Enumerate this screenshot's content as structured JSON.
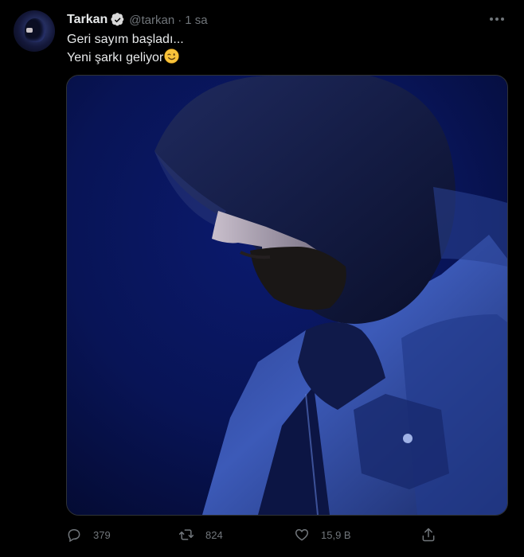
{
  "tweet": {
    "author_name": "Tarkan",
    "handle": "@tarkan",
    "separator": "·",
    "time": "1 sa",
    "verified": true,
    "text_line1": "Geri sayım başladı...",
    "text_line2": "Yeni şarkı geliyor",
    "emoji": "winking-face",
    "media_description_icon": "photo-hooded-man"
  },
  "actions": {
    "reply_count": "379",
    "retweet_count": "824",
    "like_count": "15,9 B"
  },
  "colors": {
    "background": "#000000",
    "text": "#e7e9ea",
    "muted": "#71767b",
    "verified": "#d9d9d9"
  }
}
